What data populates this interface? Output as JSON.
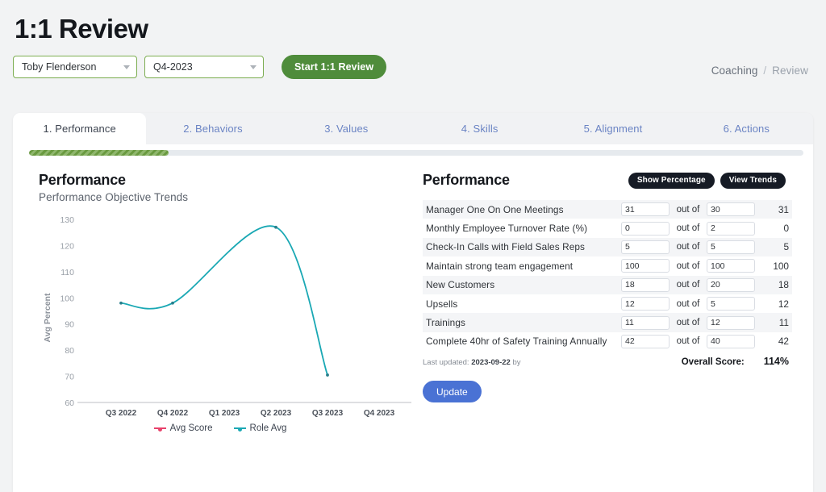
{
  "header": {
    "title": "1:1 Review",
    "person_select": {
      "value": "Toby Flenderson"
    },
    "period_select": {
      "value": "Q4-2023"
    },
    "start_button": "Start 1:1 Review",
    "breadcrumb": {
      "parent": "Coaching",
      "separator": "/",
      "current": "Review"
    }
  },
  "tabs": [
    {
      "label": "1. Performance",
      "active": true
    },
    {
      "label": "2. Behaviors",
      "active": false
    },
    {
      "label": "3. Values",
      "active": false
    },
    {
      "label": "4. Skills",
      "active": false
    },
    {
      "label": "5. Alignment",
      "active": false
    },
    {
      "label": "6. Actions",
      "active": false
    }
  ],
  "progress": {
    "percent": 18
  },
  "chart_panel": {
    "title": "Performance",
    "subtitle": "Performance Objective Trends"
  },
  "chart_data": {
    "type": "line",
    "title": "Performance Objective Trends",
    "xlabel": "",
    "ylabel": "Avg Percent",
    "x": [
      "Q3 2022",
      "Q4 2022",
      "Q1 2023",
      "Q2 2023",
      "Q3 2023",
      "Q4 2023"
    ],
    "ylim": [
      60,
      130
    ],
    "yticks": [
      60,
      70,
      80,
      90,
      100,
      110,
      120,
      130
    ],
    "grid": false,
    "legend_position": "bottom",
    "series": [
      {
        "name": "Avg Score",
        "color": "#e8426b",
        "values": [
          null,
          null,
          null,
          null,
          null,
          null
        ]
      },
      {
        "name": "Role Avg",
        "color": "#1aa8b4",
        "values": [
          98,
          98,
          null,
          127,
          70.5,
          null
        ]
      }
    ]
  },
  "table_panel": {
    "title": "Performance",
    "show_percentage_button": "Show Percentage",
    "view_trends_button": "View Trends",
    "out_of_label": "out of",
    "rows": [
      {
        "label": "Manager One On One Meetings",
        "actual": "31",
        "target": "30",
        "score": "31"
      },
      {
        "label": "Monthly Employee Turnover Rate (%)",
        "actual": "0",
        "target": "2",
        "score": "0"
      },
      {
        "label": "Check-In Calls with Field Sales Reps",
        "actual": "5",
        "target": "5",
        "score": "5"
      },
      {
        "label": "Maintain strong team engagement",
        "actual": "100",
        "target": "100",
        "score": "100"
      },
      {
        "label": "New Customers",
        "actual": "18",
        "target": "20",
        "score": "18"
      },
      {
        "label": "Upsells",
        "actual": "12",
        "target": "5",
        "score": "12"
      },
      {
        "label": "Trainings",
        "actual": "11",
        "target": "12",
        "score": "11"
      },
      {
        "label": "Complete 40hr of Safety Training Annually",
        "actual": "42",
        "target": "40",
        "score": "42"
      }
    ],
    "last_updated_prefix": "Last updated:",
    "last_updated_date": "2023-09-22",
    "last_updated_suffix": "by",
    "overall_score_label": "Overall Score:",
    "overall_score_value": "114%",
    "update_button": "Update"
  }
}
